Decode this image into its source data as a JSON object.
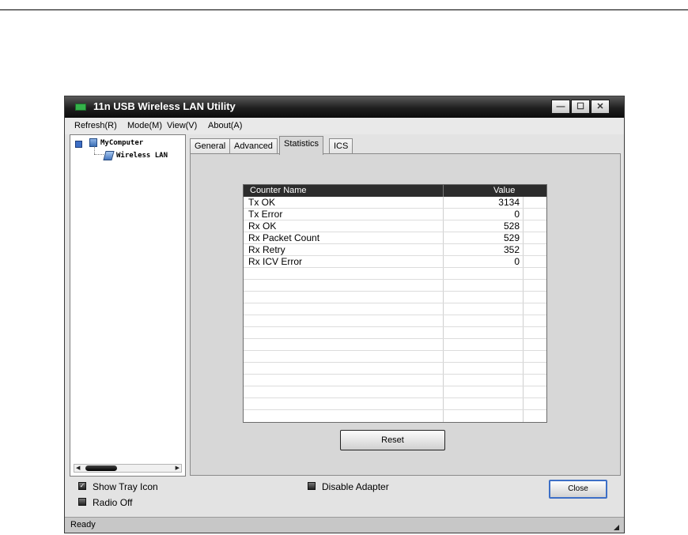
{
  "window": {
    "title": "11n USB Wireless LAN Utility",
    "controls": {
      "minimize": "—",
      "maximize": "☐",
      "close": "✕"
    }
  },
  "menu": [
    "Refresh(R)",
    "Mode(M)",
    "View(V)",
    "About(A)"
  ],
  "tree": {
    "root": "MyComputer",
    "child": "Wireless LAN"
  },
  "tabs": [
    "General",
    "Advanced",
    "Statistics",
    "ICS"
  ],
  "active_tab": "Statistics",
  "table": {
    "headers": [
      "Counter Name",
      "Value"
    ],
    "rows": [
      [
        "Tx OK",
        "3134"
      ],
      [
        "Tx Error",
        "0"
      ],
      [
        "Rx OK",
        "528"
      ],
      [
        "Rx Packet Count",
        "529"
      ],
      [
        "Rx Retry",
        "352"
      ],
      [
        "Rx ICV Error",
        "0"
      ]
    ]
  },
  "buttons": {
    "reset": "Reset",
    "close": "Close"
  },
  "options": {
    "show_tray_icon": "Show Tray Icon",
    "radio_off": "Radio Off",
    "disable_adapter": "Disable Adapter"
  },
  "status": "Ready",
  "colors": {
    "title_bar": "#1f1f1f",
    "header": "#2c2c2c",
    "focus": "#3d6fc6"
  }
}
